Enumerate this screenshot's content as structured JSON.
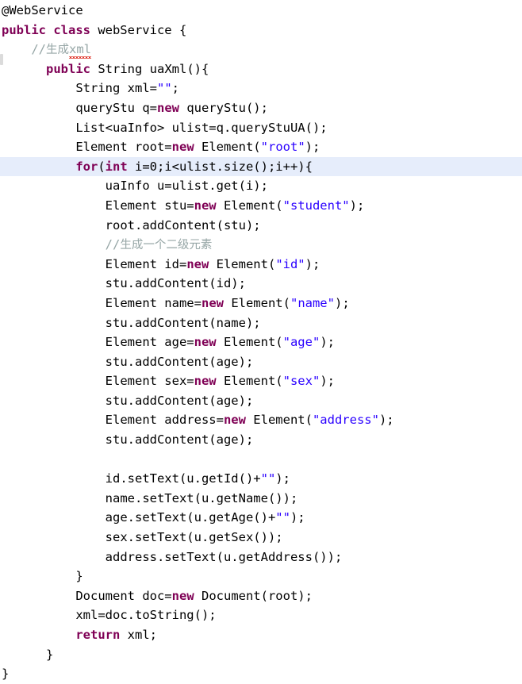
{
  "editor": {
    "language": "Java",
    "file_class_name": "webService",
    "theme": {
      "background": "#ffffff",
      "foreground": "#000000",
      "keyword": "#7f0055",
      "string": "#2a00ff",
      "comment": "#96a6a6",
      "annotation": "#646464",
      "current_line_highlight": "#e6edfb",
      "spellcheck_underline": "#e03a2f"
    },
    "current_line_number": 9,
    "gutter_marker_name": "changed-line-marker"
  },
  "lines": [
    {
      "n": 1,
      "indent": 0,
      "highlight": false,
      "tokens": [
        {
          "t": "@WebService",
          "c": "anno"
        }
      ]
    },
    {
      "n": 2,
      "indent": 0,
      "highlight": false,
      "tokens": [
        {
          "t": "public class",
          "c": "kw"
        },
        {
          "t": " webService {",
          "c": "plain"
        }
      ]
    },
    {
      "n": 3,
      "indent": 1,
      "highlight": false,
      "tokens": [
        {
          "t": "//",
          "c": "cmt"
        },
        {
          "t": "生成",
          "c": "cmt-cn"
        },
        {
          "t": "xml",
          "c": "cmt-spell"
        }
      ]
    },
    {
      "n": 4,
      "indent": 1.5,
      "highlight": false,
      "tokens": [
        {
          "t": "public",
          "c": "kw"
        },
        {
          "t": " String uaXml(){",
          "c": "plain"
        }
      ]
    },
    {
      "n": 5,
      "indent": 2.5,
      "highlight": false,
      "tokens": [
        {
          "t": "String xml=",
          "c": "plain"
        },
        {
          "t": "\"\"",
          "c": "str"
        },
        {
          "t": ";",
          "c": "plain"
        }
      ]
    },
    {
      "n": 6,
      "indent": 2.5,
      "highlight": false,
      "tokens": [
        {
          "t": "queryStu q=",
          "c": "plain"
        },
        {
          "t": "new",
          "c": "kw"
        },
        {
          "t": " queryStu();",
          "c": "plain"
        }
      ]
    },
    {
      "n": 7,
      "indent": 2.5,
      "highlight": false,
      "tokens": [
        {
          "t": "List<uaInfo> ulist=q.queryStuUA();",
          "c": "plain"
        }
      ]
    },
    {
      "n": 8,
      "indent": 2.5,
      "highlight": false,
      "tokens": [
        {
          "t": "Element root=",
          "c": "plain"
        },
        {
          "t": "new",
          "c": "kw"
        },
        {
          "t": " Element(",
          "c": "plain"
        },
        {
          "t": "\"root\"",
          "c": "str"
        },
        {
          "t": ");",
          "c": "plain"
        }
      ]
    },
    {
      "n": 9,
      "indent": 2.5,
      "highlight": true,
      "tokens": [
        {
          "t": "for",
          "c": "kw"
        },
        {
          "t": "(",
          "c": "plain"
        },
        {
          "t": "int",
          "c": "kw"
        },
        {
          "t": " i=0;i<ulist.size();i++){",
          "c": "plain"
        }
      ]
    },
    {
      "n": 10,
      "indent": 3.5,
      "highlight": false,
      "tokens": [
        {
          "t": "uaInfo u=ulist.get(i);",
          "c": "plain"
        }
      ]
    },
    {
      "n": 11,
      "indent": 3.5,
      "highlight": false,
      "tokens": [
        {
          "t": "Element stu=",
          "c": "plain"
        },
        {
          "t": "new",
          "c": "kw"
        },
        {
          "t": " Element(",
          "c": "plain"
        },
        {
          "t": "\"student\"",
          "c": "str"
        },
        {
          "t": ");",
          "c": "plain"
        }
      ]
    },
    {
      "n": 12,
      "indent": 3.5,
      "highlight": false,
      "tokens": [
        {
          "t": "root.addContent(stu);",
          "c": "plain"
        }
      ]
    },
    {
      "n": 13,
      "indent": 3.5,
      "highlight": false,
      "tokens": [
        {
          "t": "//",
          "c": "cmt"
        },
        {
          "t": "生成一个二级元素",
          "c": "cmt-cn"
        }
      ]
    },
    {
      "n": 14,
      "indent": 3.5,
      "highlight": false,
      "tokens": [
        {
          "t": "Element id=",
          "c": "plain"
        },
        {
          "t": "new",
          "c": "kw"
        },
        {
          "t": " Element(",
          "c": "plain"
        },
        {
          "t": "\"id\"",
          "c": "str"
        },
        {
          "t": ");",
          "c": "plain"
        }
      ]
    },
    {
      "n": 15,
      "indent": 3.5,
      "highlight": false,
      "tokens": [
        {
          "t": "stu.addContent(id);",
          "c": "plain"
        }
      ]
    },
    {
      "n": 16,
      "indent": 3.5,
      "highlight": false,
      "tokens": [
        {
          "t": "Element name=",
          "c": "plain"
        },
        {
          "t": "new",
          "c": "kw"
        },
        {
          "t": " Element(",
          "c": "plain"
        },
        {
          "t": "\"name\"",
          "c": "str"
        },
        {
          "t": ");",
          "c": "plain"
        }
      ]
    },
    {
      "n": 17,
      "indent": 3.5,
      "highlight": false,
      "tokens": [
        {
          "t": "stu.addContent(name);",
          "c": "plain"
        }
      ]
    },
    {
      "n": 18,
      "indent": 3.5,
      "highlight": false,
      "tokens": [
        {
          "t": "Element age=",
          "c": "plain"
        },
        {
          "t": "new",
          "c": "kw"
        },
        {
          "t": " Element(",
          "c": "plain"
        },
        {
          "t": "\"age\"",
          "c": "str"
        },
        {
          "t": ");",
          "c": "plain"
        }
      ]
    },
    {
      "n": 19,
      "indent": 3.5,
      "highlight": false,
      "tokens": [
        {
          "t": "stu.addContent(age);",
          "c": "plain"
        }
      ]
    },
    {
      "n": 20,
      "indent": 3.5,
      "highlight": false,
      "tokens": [
        {
          "t": "Element sex=",
          "c": "plain"
        },
        {
          "t": "new",
          "c": "kw"
        },
        {
          "t": " Element(",
          "c": "plain"
        },
        {
          "t": "\"sex\"",
          "c": "str"
        },
        {
          "t": ");",
          "c": "plain"
        }
      ]
    },
    {
      "n": 21,
      "indent": 3.5,
      "highlight": false,
      "tokens": [
        {
          "t": "stu.addContent(age);",
          "c": "plain"
        }
      ]
    },
    {
      "n": 22,
      "indent": 3.5,
      "highlight": false,
      "tokens": [
        {
          "t": "Element address=",
          "c": "plain"
        },
        {
          "t": "new",
          "c": "kw"
        },
        {
          "t": " Element(",
          "c": "plain"
        },
        {
          "t": "\"address\"",
          "c": "str"
        },
        {
          "t": ");",
          "c": "plain"
        }
      ]
    },
    {
      "n": 23,
      "indent": 3.5,
      "highlight": false,
      "tokens": [
        {
          "t": "stu.addContent(age);",
          "c": "plain"
        }
      ]
    },
    {
      "n": 24,
      "indent": 0,
      "highlight": false,
      "tokens": []
    },
    {
      "n": 25,
      "indent": 3.5,
      "highlight": false,
      "tokens": [
        {
          "t": "id.setText(u.getId()+",
          "c": "plain"
        },
        {
          "t": "\"\"",
          "c": "str"
        },
        {
          "t": ");",
          "c": "plain"
        }
      ]
    },
    {
      "n": 26,
      "indent": 3.5,
      "highlight": false,
      "tokens": [
        {
          "t": "name.setText(u.getName());",
          "c": "plain"
        }
      ]
    },
    {
      "n": 27,
      "indent": 3.5,
      "highlight": false,
      "tokens": [
        {
          "t": "age.setText(u.getAge()+",
          "c": "plain"
        },
        {
          "t": "\"\"",
          "c": "str"
        },
        {
          "t": ");",
          "c": "plain"
        }
      ]
    },
    {
      "n": 28,
      "indent": 3.5,
      "highlight": false,
      "tokens": [
        {
          "t": "sex.setText(u.getSex());",
          "c": "plain"
        }
      ]
    },
    {
      "n": 29,
      "indent": 3.5,
      "highlight": false,
      "tokens": [
        {
          "t": "address.setText(u.getAddress());",
          "c": "plain"
        }
      ]
    },
    {
      "n": 30,
      "indent": 2.5,
      "highlight": false,
      "tokens": [
        {
          "t": "}",
          "c": "plain"
        }
      ]
    },
    {
      "n": 31,
      "indent": 2.5,
      "highlight": false,
      "tokens": [
        {
          "t": "Document doc=",
          "c": "plain"
        },
        {
          "t": "new",
          "c": "kw"
        },
        {
          "t": " Document(root);",
          "c": "plain"
        }
      ]
    },
    {
      "n": 32,
      "indent": 2.5,
      "highlight": false,
      "tokens": [
        {
          "t": "xml=doc.toString();",
          "c": "plain"
        }
      ]
    },
    {
      "n": 33,
      "indent": 2.5,
      "highlight": false,
      "tokens": [
        {
          "t": "return",
          "c": "kw"
        },
        {
          "t": " xml;",
          "c": "plain"
        }
      ]
    },
    {
      "n": 34,
      "indent": 1.5,
      "highlight": false,
      "tokens": [
        {
          "t": "}",
          "c": "plain"
        }
      ]
    },
    {
      "n": 35,
      "indent": 0,
      "highlight": false,
      "tokens": [
        {
          "t": "}",
          "c": "plain"
        }
      ]
    }
  ]
}
